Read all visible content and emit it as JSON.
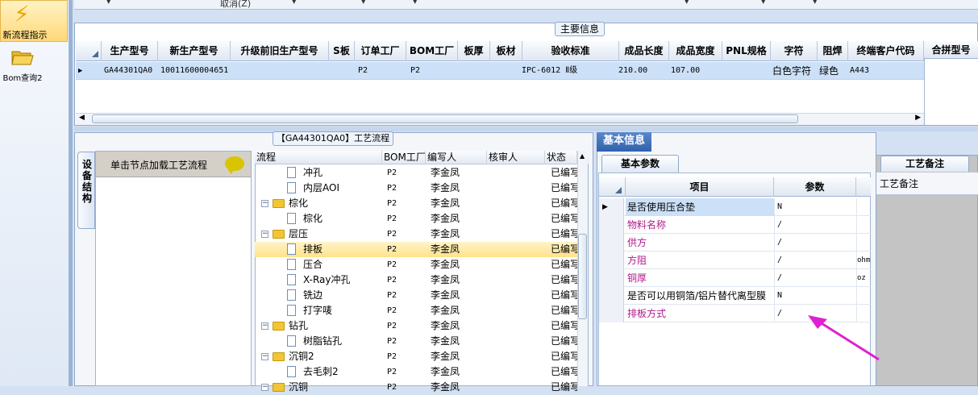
{
  "nav": {
    "item1": "新流程指示",
    "item2": "Bom查询2"
  },
  "toolbar": {
    "cancel_label": "取消(Z)"
  },
  "main_info": {
    "tab_label": "主要信息",
    "columns": [
      "生产型号",
      "新生产型号",
      "升级前旧生产型号",
      "S板",
      "订单工厂",
      "BOM工厂",
      "板厚",
      "板材",
      "验收标准",
      "成品长度",
      "成品宽度",
      "PNL规格",
      "字符",
      "阻焊",
      "终端客户代码"
    ],
    "extra_column": "合拼型号",
    "row": {
      "model": "GA44301QA0",
      "new_model": "10011600004651",
      "old_model": "",
      "s_board": "",
      "order_factory": "P2",
      "bom_factory": "P2",
      "thickness": "",
      "material": "",
      "standard": "IPC-6012 Ⅱ级",
      "length": "210.00",
      "width": "107.00",
      "pnl": "",
      "char": "白色字符",
      "solder": "绿色",
      "customer_code": "A443"
    }
  },
  "process": {
    "tab_label": "【GA44301QA0】工艺流程",
    "side_tab": "设备结构",
    "click_hint": "单击节点加载工艺流程",
    "tree_columns": [
      "流程",
      "BOM工厂",
      "编写人",
      "核审人",
      "状态"
    ],
    "rows": [
      {
        "name": "冲孔",
        "type": "doc",
        "level": 2,
        "factory": "P2",
        "writer": "李金凤",
        "status": "已编写"
      },
      {
        "name": "内层AOI",
        "type": "doc",
        "level": 2,
        "factory": "P2",
        "writer": "李金凤",
        "status": "已编写"
      },
      {
        "name": "棕化",
        "type": "folder",
        "level": 1,
        "factory": "P2",
        "writer": "李金凤",
        "status": "已编写"
      },
      {
        "name": "棕化",
        "type": "doc",
        "level": 2,
        "factory": "P2",
        "writer": "李金凤",
        "status": "已编写"
      },
      {
        "name": "层压",
        "type": "folder",
        "level": 1,
        "factory": "P2",
        "writer": "李金凤",
        "status": "已编写"
      },
      {
        "name": "排板",
        "type": "doc",
        "level": 2,
        "factory": "P2",
        "writer": "李金凤",
        "status": "已编写",
        "selected": true
      },
      {
        "name": "压合",
        "type": "doc",
        "level": 2,
        "factory": "P2",
        "writer": "李金凤",
        "status": "已编写"
      },
      {
        "name": "X-Ray冲孔",
        "type": "doc",
        "level": 2,
        "factory": "P2",
        "writer": "李金凤",
        "status": "已编写"
      },
      {
        "name": "铣边",
        "type": "doc",
        "level": 2,
        "factory": "P2",
        "writer": "李金凤",
        "status": "已编写"
      },
      {
        "name": "打字唛",
        "type": "doc",
        "level": 2,
        "factory": "P2",
        "writer": "李金凤",
        "status": "已编写"
      },
      {
        "name": "钻孔",
        "type": "folder",
        "level": 1,
        "factory": "P2",
        "writer": "李金凤",
        "status": "已编写"
      },
      {
        "name": "树脂钻孔",
        "type": "doc",
        "level": 2,
        "factory": "P2",
        "writer": "李金凤",
        "status": "已编写"
      },
      {
        "name": "沉铜2",
        "type": "folder",
        "level": 1,
        "factory": "P2",
        "writer": "李金凤",
        "status": "已编写"
      },
      {
        "name": "去毛刺2",
        "type": "doc",
        "level": 2,
        "factory": "P2",
        "writer": "李金凤",
        "status": "已编写"
      },
      {
        "name": "沉铜",
        "type": "folder",
        "level": 1,
        "factory": "P2",
        "writer": "李金凤",
        "status": "已编写"
      }
    ]
  },
  "basic_info": {
    "header": "基本信息",
    "subtab": "基本参数",
    "col_item": "项目",
    "col_param": "参数",
    "rows": [
      {
        "item": "是否使用压合垫",
        "param": "N",
        "unit": "",
        "color": "normal",
        "highlight": true
      },
      {
        "item": "物料名称",
        "param": "/",
        "unit": "",
        "color": "magenta"
      },
      {
        "item": "供方",
        "param": "/",
        "unit": "",
        "color": "magenta"
      },
      {
        "item": "方阻",
        "param": "/",
        "unit": "ohm",
        "color": "magenta"
      },
      {
        "item": "铜厚",
        "param": "/",
        "unit": "oz",
        "color": "magenta"
      },
      {
        "item": "是否可以用铜箔/铝片替代离型膜",
        "param": "N",
        "unit": "",
        "color": "normal"
      },
      {
        "item": "排板方式",
        "param": "/",
        "unit": "",
        "color": "magenta"
      }
    ]
  },
  "remark": {
    "tab": "工艺备注",
    "header": "工艺备注"
  },
  "colors": {
    "accent": "#2f61ad",
    "magenta": "#b0198c",
    "selection": "#cce0f7",
    "arrow": "#e020d0"
  }
}
